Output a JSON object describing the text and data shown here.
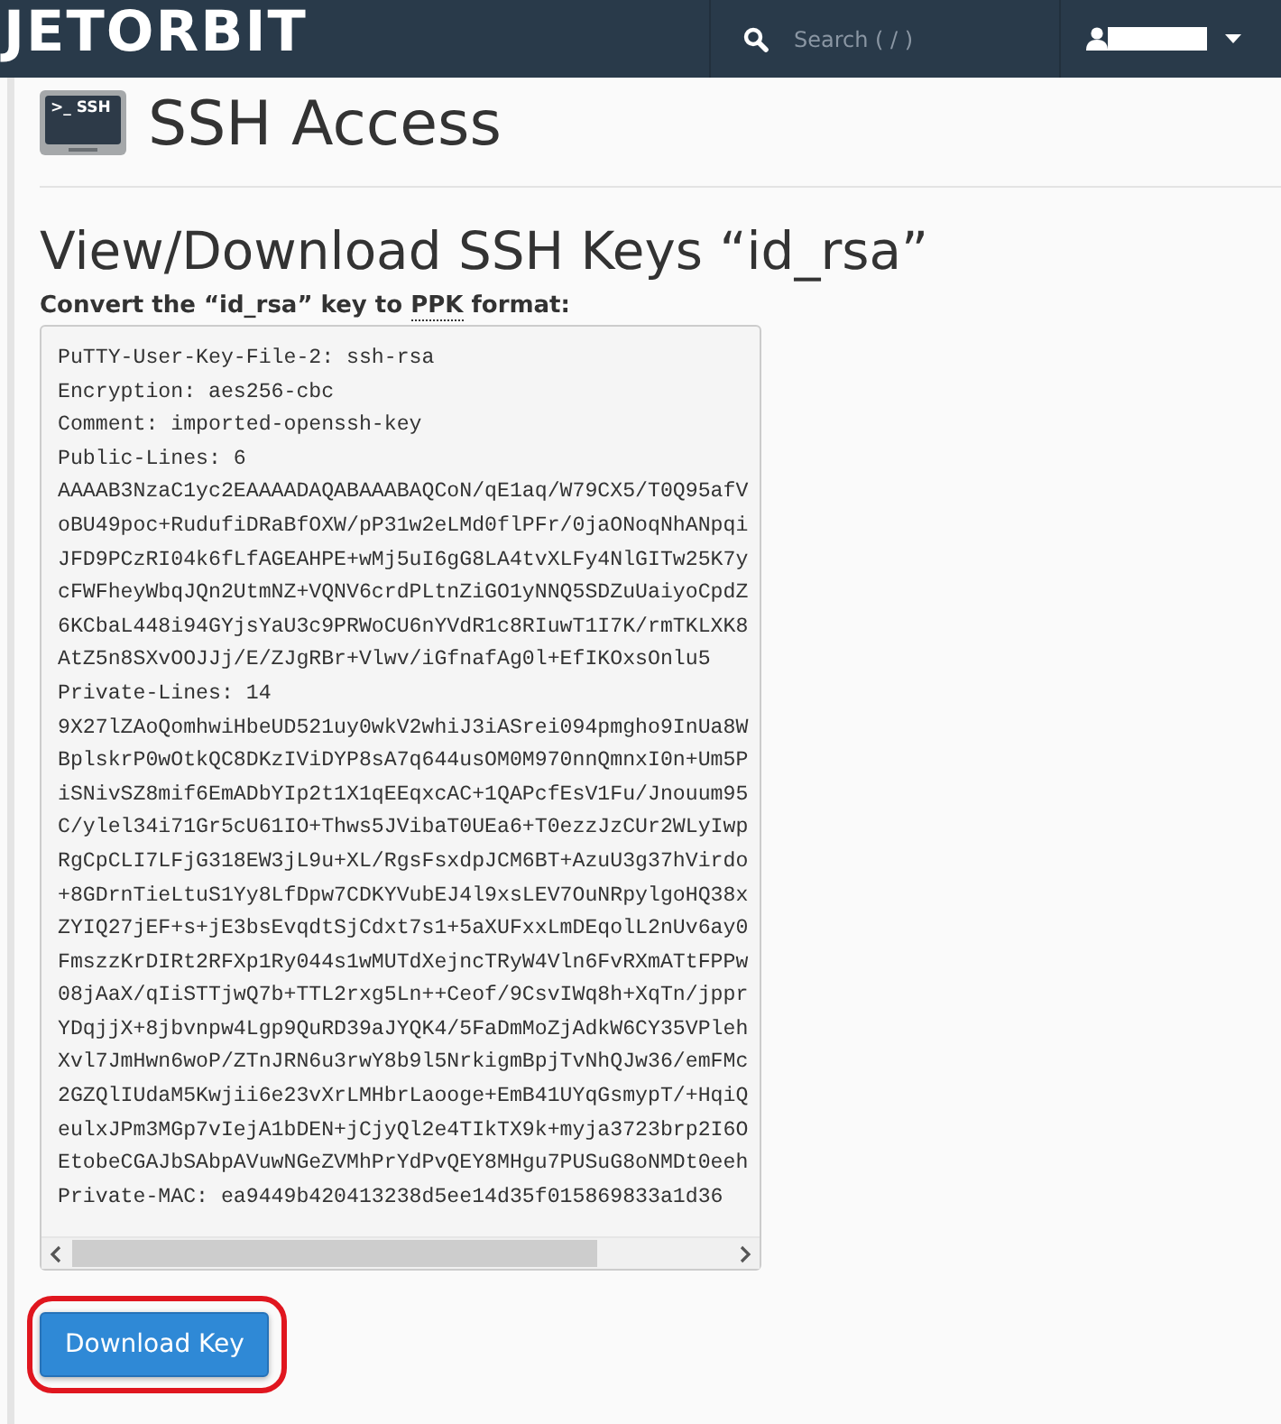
{
  "navbar": {
    "logo": "JETORBIT",
    "search": {
      "placeholder": "Search ( / )"
    }
  },
  "page": {
    "title": "SSH Access",
    "icon_label": ">_ SSH"
  },
  "section": {
    "heading": "View/Download SSH Keys “id_rsa”",
    "label": {
      "before": "Convert the “id_rsa” key to ",
      "abbr": "PPK",
      "after": " format:"
    }
  },
  "key_lines": [
    "PuTTY-User-Key-File-2: ssh-rsa",
    "Encryption: aes256-cbc",
    "Comment: imported-openssh-key",
    "Public-Lines: 6",
    "AAAAB3NzaC1yc2EAAAADAQABAAABAQCoN/qE1aq/W79CX5/T0Q95afV",
    "oBU49poc+RudufiDRaBfOXW/pP31w2eLMd0flPFr/0jaONoqNhANpqi",
    "JFD9PCzRI04k6fLfAGEAHPE+wMj5uI6gG8LA4tvXLFy4NlGITw25K7y",
    "cFWFheyWbqJQn2UtmNZ+VQNV6crdPLtnZiGO1yNNQ5SDZuUaiyoCpdZ",
    "6KCbaL448i94GYjsYaU3c9PRWoCU6nYVdR1c8RIuwT1I7K/rmTKLXK8",
    "AtZ5n8SXvOOJJj/E/ZJgRBr+Vlwv/iGfnafAg0l+EfIKOxsOnlu5",
    "Private-Lines: 14",
    "9X27lZAoQomhwiHbeUD521uy0wkV2whiJ3iASrei094pmgho9InUa8W",
    "BplskrP0wOtkQC8DKzIViDYP8sA7q644usOM0M970nnQmnxI0n+Um5P",
    "iSNivSZ8mif6EmADbYIp2t1X1qEEqxcAC+1QAPcfEsV1Fu/Jnouum95",
    "C/ylel34i71Gr5cU61IO+Thws5JVibaT0UEa6+T0ezzJzCUr2WLyIwp",
    "RgCpCLI7LFjG318EW3jL9u+XL/RgsFsxdpJCM6BT+AzuU3g37hVirdo",
    "+8GDrnTieLtuS1Yy8LfDpw7CDKYVubEJ4l9xsLEV7OuNRpylgoHQ38x",
    "ZYIQ27jEF+s+jE3bsEvqdtSjCdxt7s1+5aXUFxxLmDEqolL2nUv6ay0",
    "FmszzKrDIRt2RFXp1Ry044s1wMUTdXejncTRyW4Vln6FvRXmATtFPPw",
    "08jAaX/qIiSTTjwQ7b+TTL2rxg5Ln++Ceof/9CsvIWq8h+XqTn/jppr",
    "YDqjjX+8jbvnpw4Lgp9QuRD39aJYQK4/5FaDmMoZjAdkW6CY35VPleh",
    "Xvl7JmHwn6woP/ZTnJRN6u3rwY8b9l5NrkigmBpjTvNhQJw36/emFMc",
    "2GZQlIUdaM5Kwjii6e23vXrLMHbrLaooge+EmB41UYqGsmypT/+HqiQ",
    "eulxJPm3MGp7vIejA1bDEN+jCjyQl2e4TIkTX9k+myja3723brp2I6O",
    "EtobeCGAJbSAbpAVuwNGeZVMhPrYdPvQEY8MHgu7PUSuG8oNMDt0eeh",
    "Private-MAC: ea9449b420413238d5ee14d35f015869833a1d36"
  ],
  "download_button": "Download Key"
}
